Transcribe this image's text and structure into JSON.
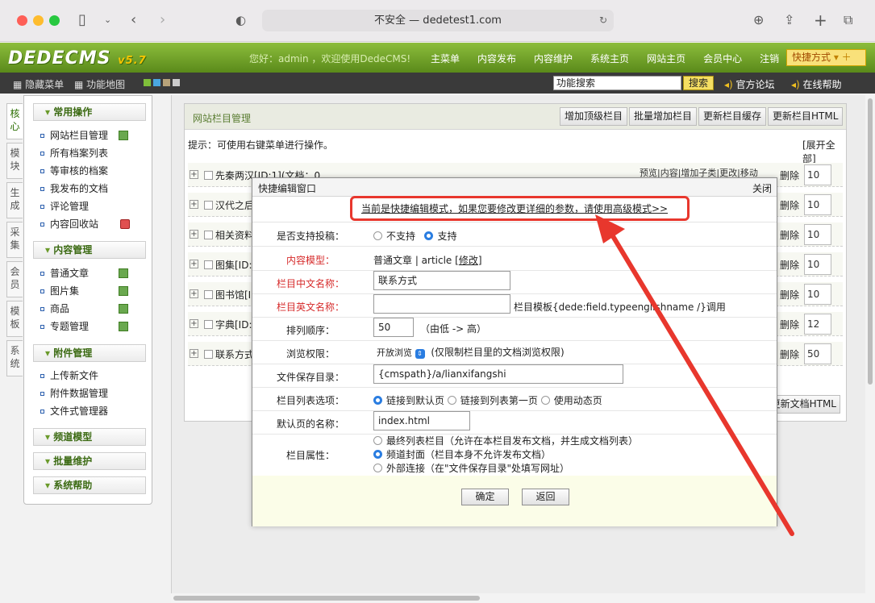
{
  "browser": {
    "url": "不安全 — dedetest1.com"
  },
  "header": {
    "logo": "DEDECMS",
    "version": "v5.7",
    "welcome": "您好：admin ，欢迎使用DedeCMS!",
    "nav": [
      "主菜单",
      "内容发布",
      "内容维护",
      "系统主页",
      "网站主页",
      "会员中心",
      "注销"
    ],
    "quick": "快捷方式"
  },
  "subbar": {
    "hide_menu": "隐藏菜单",
    "sitemap": "功能地图",
    "search_value": "功能搜索",
    "search_btn": "搜索",
    "forum": "官方论坛",
    "help": "在线帮助"
  },
  "side_tabs": [
    "核心",
    "模块",
    "生成",
    "采集",
    "会员",
    "模板",
    "系统"
  ],
  "left_menu": {
    "common_ops": "常用操作",
    "common_items": [
      "网站栏目管理",
      "所有档案列表",
      "等审核的档案",
      "我发布的文档",
      "评论管理",
      "内容回收站"
    ],
    "content_mgmt": "内容管理",
    "content_items": [
      "普通文章",
      "图片集",
      "商品",
      "专题管理"
    ],
    "attach_mgmt": "附件管理",
    "attach_items": [
      "上传新文件",
      "附件数据管理",
      "文件式管理器"
    ],
    "channel_model": "频道模型",
    "batch": "批量维护",
    "sys_help": "系统帮助"
  },
  "panel": {
    "title": "网站栏目管理",
    "buttons": [
      "增加顶级栏目",
      "批量增加栏目",
      "更新栏目缓存",
      "更新栏目HTML"
    ],
    "hint": "提示：可使用右键菜单进行操作。",
    "expand": "[展开全部]",
    "update_docs": "更新文档HTML",
    "row_ops": "预览|内容|增加子类|更改|移动",
    "delete": "删除",
    "rows": [
      {
        "name": "先秦两汉[ID:1](文档：0)",
        "sort": "10"
      },
      {
        "name": "汉代之后",
        "sort": "10"
      },
      {
        "name": "相关资料",
        "sort": "10"
      },
      {
        "name": "图集[ID:",
        "sort": "10"
      },
      {
        "name": "图书馆[ID",
        "sort": "10"
      },
      {
        "name": "字典[ID:",
        "sort": "12"
      },
      {
        "name": "联系方式",
        "sort": "50"
      }
    ]
  },
  "modal": {
    "title": "快捷编辑窗口",
    "close": "关闭",
    "tip": "当前是快捷编辑模式，如果您要修改更详细的参数，请使用高级模式>>",
    "f_submit": "是否支持投稿：",
    "submit_no": "不支持",
    "submit_yes": "支持",
    "f_model": "内容模型：",
    "model_value": "普通文章 | article [",
    "model_edit": "修改",
    "model_end": "]",
    "f_cn": "栏目中文名称：",
    "cn_value": "联系方式",
    "f_en": "栏目英文名称：",
    "en_value": "",
    "en_note": "栏目模板{dede:field.typeenglishname /}调用",
    "f_sort": "排列顺序：",
    "sort_value": "50",
    "sort_note": "（由低 -> 高）",
    "f_browse": "浏览权限：",
    "browse_value": "开放浏览",
    "browse_note": "(仅限制栏目里的文档浏览权限)",
    "f_dir": "文件保存目录：",
    "dir_value": "{cmspath}/a/lianxifangshi",
    "f_list": "栏目列表选项：",
    "list_opts": [
      "链接到默认页",
      "链接到列表第一页",
      "使用动态页"
    ],
    "f_default": "默认页的名称：",
    "default_value": "index.html",
    "f_attr": "栏目属性：",
    "attr_opts": [
      "最终列表栏目（允许在本栏目发布文档，并生成文档列表）",
      "频道封面（栏目本身不允许发布文档）",
      "外部连接（在\"文件保存目录\"处填写网址）"
    ],
    "ok": "确定",
    "back": "返回"
  },
  "colors": {
    "accent_red": "#e8372d",
    "brand_green": "#6fa32a",
    "radio_blue": "#2a7de1"
  }
}
